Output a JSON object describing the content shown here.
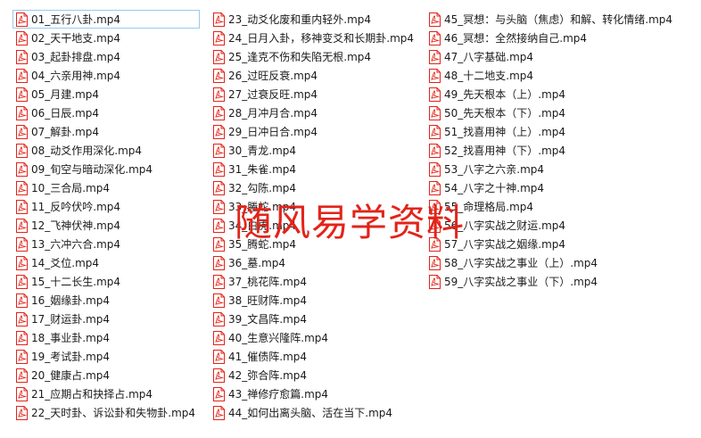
{
  "files": {
    "column1": [
      "01_五行八卦.mp4",
      "02_天干地支.mp4",
      "03_起卦排盘.mp4",
      "04_六亲用神.mp4",
      "05_月建.mp4",
      "06_日辰.mp4",
      "07_解卦.mp4",
      "08_动爻作用深化.mp4",
      "09_旬空与暗动深化.mp4",
      "10_三合局.mp4",
      "11_反吟伏吟.mp4",
      "12_飞神伏神.mp4",
      "13_六冲六合.mp4",
      "14_爻位.mp4",
      "15_十二长生.mp4",
      "16_姻缘卦.mp4",
      "17_财运卦.mp4",
      "18_事业卦.mp4",
      "19_考试卦.mp4",
      "20_健康占.mp4",
      "21_应期占和抉择占.mp4",
      "22_天时卦、诉讼卦和失物卦.mp4"
    ],
    "column2": [
      "23_动爻化废和重内轻外.mp4",
      "24_日月入卦，移神变爻和长期卦.mp4",
      "25_逢克不伤和失陷无根.mp4",
      "26_过旺反衰.mp4",
      "27_过衰反旺.mp4",
      "28_月冲月合.mp4",
      "29_日冲日合.mp4",
      "30_青龙.mp4",
      "31_朱雀.mp4",
      "32_勾陈.mp4",
      "33_螣蛇.mp4",
      "34_白虎.mp4",
      "35_腾蛇.mp4",
      "36_墓.mp4",
      "37_桃花阵.mp4",
      "38_旺财阵.mp4",
      "39_文昌阵.mp4",
      "40_生意兴隆阵.mp4",
      "41_催债阵.mp4",
      "42_弥合阵.mp4",
      "43_禅修疗愈篇.mp4",
      "44_如何出离头脑、活在当下.mp4"
    ],
    "column3": [
      "45_冥想：与头脑（焦虑）和解、转化情绪.mp4",
      "46_冥想：全然接纳自己.mp4",
      "47_八字基础.mp4",
      "48_十二地支.mp4",
      "49_先天根本（上）.mp4",
      "50_先天根本（下）.mp4",
      "51_找喜用神（上）.mp4",
      "52_找喜用神（下）.mp4",
      "53_八字之六亲.mp4",
      "54_八字之十神.mp4",
      "55_命理格局.mp4",
      "56_八字实战之财运.mp4",
      "57_八字实战之姻缘.mp4",
      "58_八字实战之事业（上）.mp4",
      "59_八字实战之事业（下）.mp4"
    ]
  },
  "watermark": "随风易学资料",
  "icon": {
    "name": "pdf-file-icon",
    "color": "#e2241a"
  },
  "colors": {
    "selection_border": "#99c9ef",
    "text": "#1a1a1a"
  }
}
